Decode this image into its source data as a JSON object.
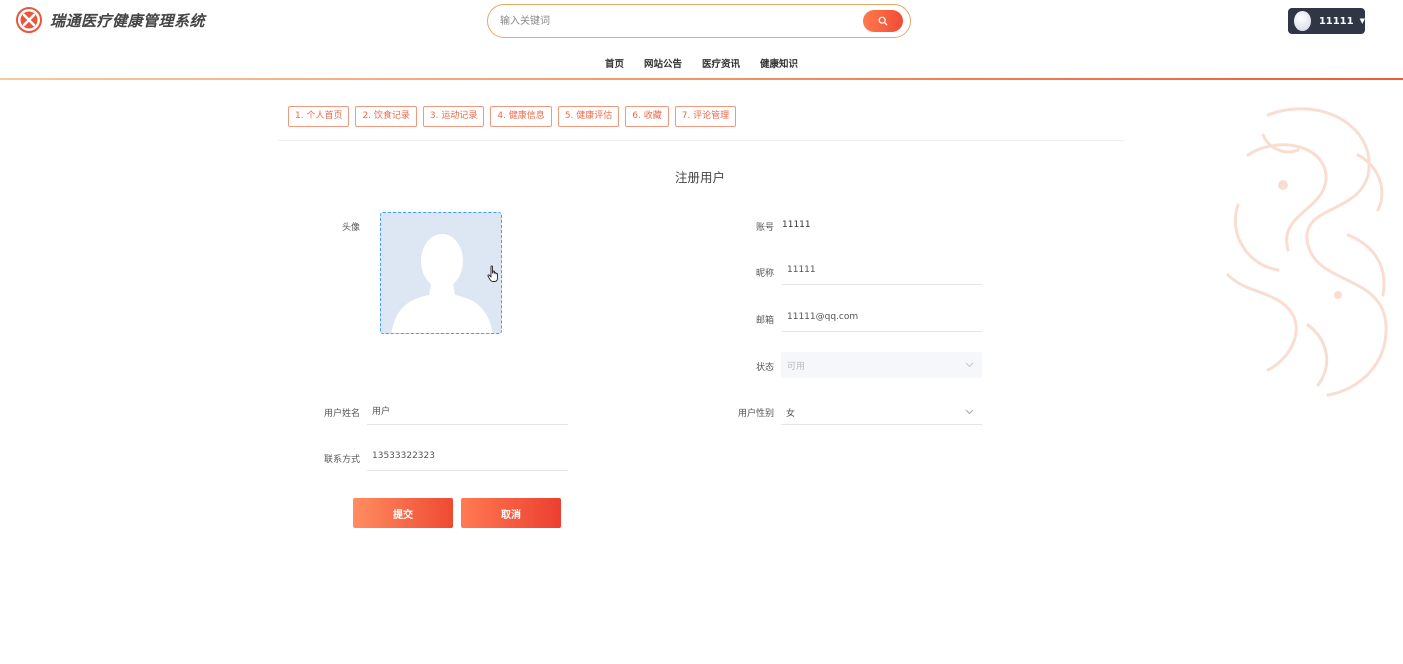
{
  "header": {
    "app_title": "瑞通医疗健康管理系统",
    "search_placeholder": "输入关键词",
    "user_name": "11111"
  },
  "nav": [
    "首页",
    "网站公告",
    "医疗资讯",
    "健康知识"
  ],
  "tabs": [
    "1. 个人首页",
    "2. 饮食记录",
    "3. 运动记录",
    "4. 健康信息",
    "5. 健康评估",
    "6. 收藏",
    "7. 评论管理"
  ],
  "form": {
    "title": "注册用户",
    "avatar_label": "头像",
    "account_label": "账号",
    "account_value": "11111",
    "nickname_label": "昵称",
    "nickname_value": "11111",
    "email_label": "邮箱",
    "email_value": "11111@qq.com",
    "status_label": "状态",
    "status_value": "可用",
    "name_label": "用户姓名",
    "name_value": "用户",
    "gender_label": "用户性别",
    "gender_value": "女",
    "phone_label": "联系方式",
    "phone_value": "13533322323",
    "submit_label": "提交",
    "cancel_label": "取消"
  },
  "colors": {
    "accent_start": "#ff8d60",
    "accent_end": "#ef4a33",
    "tab_border": "#ee9a80",
    "user_badge": "#303646"
  }
}
